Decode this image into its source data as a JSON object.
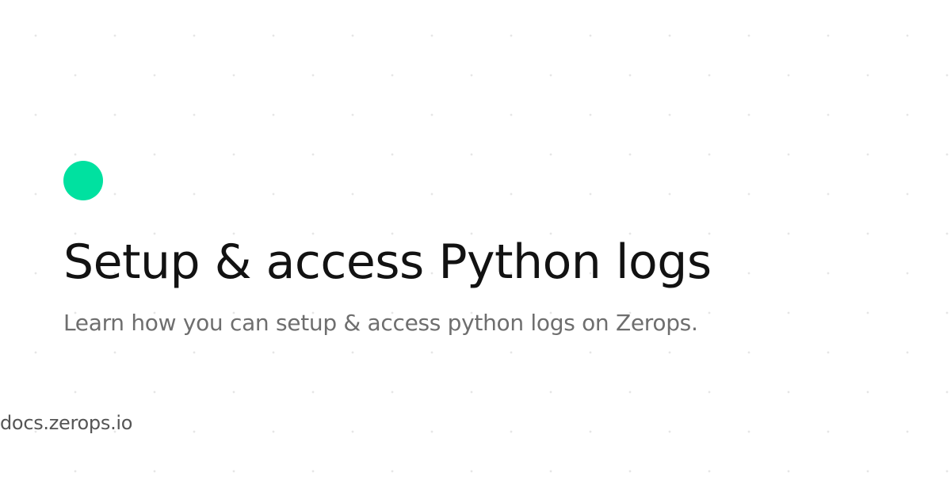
{
  "card": {
    "title": "Setup & access Python logs",
    "subtitle": "Learn how you can setup & access python logs on Zerops.",
    "domain": "docs.zerops.io"
  },
  "colors": {
    "brand_dot": "#00e1a0",
    "background": "#ffffff",
    "title": "#121212",
    "subtitle": "#6e6e6e",
    "domain": "#555555"
  },
  "icons": {
    "brand_mark": "green-circle-icon"
  }
}
